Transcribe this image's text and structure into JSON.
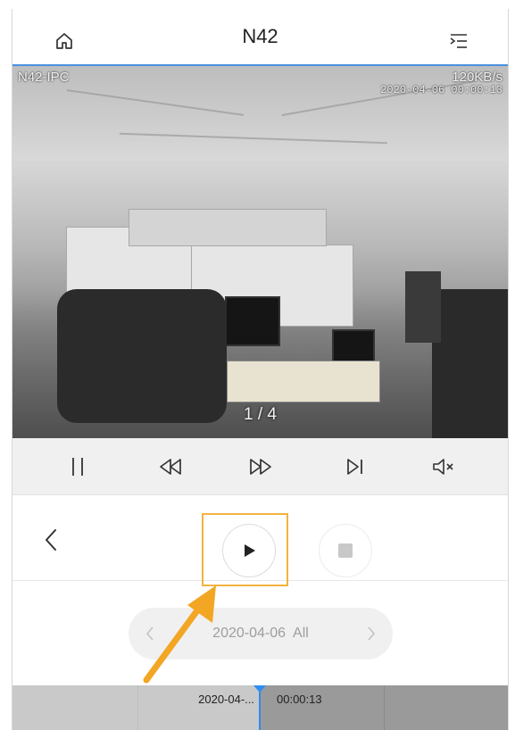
{
  "header": {
    "title": "N42",
    "home_icon": "home-icon",
    "menu_icon": "list-collapse-icon"
  },
  "video": {
    "channel_label": "N42-IPC",
    "bitrate": "120KB/s",
    "timestamp": "2020-04-06 00:00:13",
    "page_indicator": "1 / 4"
  },
  "toolbar": {
    "buttons": [
      {
        "icon": "pause-icon"
      },
      {
        "icon": "rewind-icon"
      },
      {
        "icon": "fast-forward-icon"
      },
      {
        "icon": "next-frame-icon"
      },
      {
        "icon": "mute-icon"
      }
    ]
  },
  "controls": {
    "back_icon": "chevron-left-icon",
    "play_icon": "play-icon",
    "stop_icon": "stop-icon"
  },
  "date_selector": {
    "date": "2020-04-06",
    "filter": "All",
    "label": "2020-04-06  All",
    "prev_icon": "chevron-left-icon",
    "next_icon": "chevron-right-icon"
  },
  "timeline": {
    "left_label": "2020-04-...",
    "right_label": "00:00:13"
  },
  "colors": {
    "accent": "#2f8cf0",
    "highlight": "#f2b33d",
    "video_border": "#4a90e2"
  }
}
